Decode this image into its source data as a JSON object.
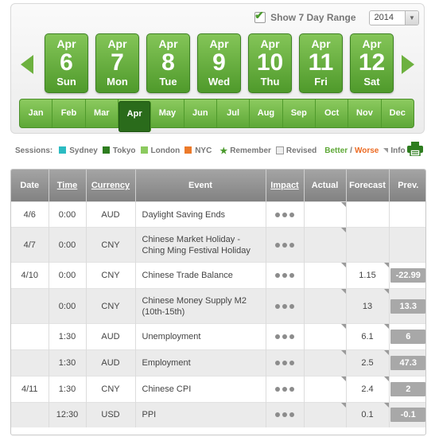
{
  "range": {
    "checkbox_label": "Show 7 Day Range",
    "year": "2014"
  },
  "days": [
    {
      "month": "Apr",
      "num": "6",
      "weekday": "Sun"
    },
    {
      "month": "Apr",
      "num": "7",
      "weekday": "Mon"
    },
    {
      "month": "Apr",
      "num": "8",
      "weekday": "Tue"
    },
    {
      "month": "Apr",
      "num": "9",
      "weekday": "Wed"
    },
    {
      "month": "Apr",
      "num": "10",
      "weekday": "Thu"
    },
    {
      "month": "Apr",
      "num": "11",
      "weekday": "Fri"
    },
    {
      "month": "Apr",
      "num": "12",
      "weekday": "Sat"
    }
  ],
  "months": [
    "Jan",
    "Feb",
    "Mar",
    "Apr",
    "May",
    "Jun",
    "Jul",
    "Aug",
    "Sep",
    "Oct",
    "Nov",
    "Dec"
  ],
  "active_month": "Apr",
  "legend": {
    "sessions_label": "Sessions:",
    "sessions": [
      {
        "name": "Sydney",
        "color": "#2bbbc2"
      },
      {
        "name": "Tokyo",
        "color": "#2e7d1f"
      },
      {
        "name": "London",
        "color": "#8cca5f"
      },
      {
        "name": "NYC",
        "color": "#ec7a2a"
      }
    ],
    "remember": "Remember",
    "revised": "Revised",
    "better": "Better",
    "slash": "/",
    "worse": "Worse",
    "info": "Info"
  },
  "table": {
    "headers": {
      "date": "Date",
      "time": "Time",
      "currency": "Currency",
      "event": "Event",
      "impact": "Impact",
      "actual": "Actual",
      "forecast": "Forecast",
      "prev": "Prev."
    },
    "rows": [
      {
        "date": "4/6",
        "time": "0:00",
        "currency": "AUD",
        "event": "Daylight Saving Ends",
        "actual": "",
        "forecast": "",
        "prev": ""
      },
      {
        "date": "4/7",
        "time": "0:00",
        "currency": "CNY",
        "event": "Chinese Market Holiday - Ching Ming Festival Holiday",
        "actual": "",
        "forecast": "",
        "prev": ""
      },
      {
        "date": "4/10",
        "time": "0:00",
        "currency": "CNY",
        "event": "Chinese Trade Balance",
        "actual": "",
        "forecast": "1.15",
        "prev": "-22.99"
      },
      {
        "date": "",
        "time": "0:00",
        "currency": "CNY",
        "event": "Chinese Money Supply M2 (10th-15th)",
        "actual": "",
        "forecast": "13",
        "prev": "13.3"
      },
      {
        "date": "",
        "time": "1:30",
        "currency": "AUD",
        "event": "Unemployment",
        "actual": "",
        "forecast": "6.1",
        "prev": "6"
      },
      {
        "date": "",
        "time": "1:30",
        "currency": "AUD",
        "event": "Employment",
        "actual": "",
        "forecast": "2.5",
        "prev": "47.3"
      },
      {
        "date": "4/11",
        "time": "1:30",
        "currency": "CNY",
        "event": "Chinese CPI",
        "actual": "",
        "forecast": "2.4",
        "prev": "2"
      },
      {
        "date": "",
        "time": "12:30",
        "currency": "USD",
        "event": "PPI",
        "actual": "",
        "forecast": "0.1",
        "prev": "-0.1"
      }
    ]
  }
}
